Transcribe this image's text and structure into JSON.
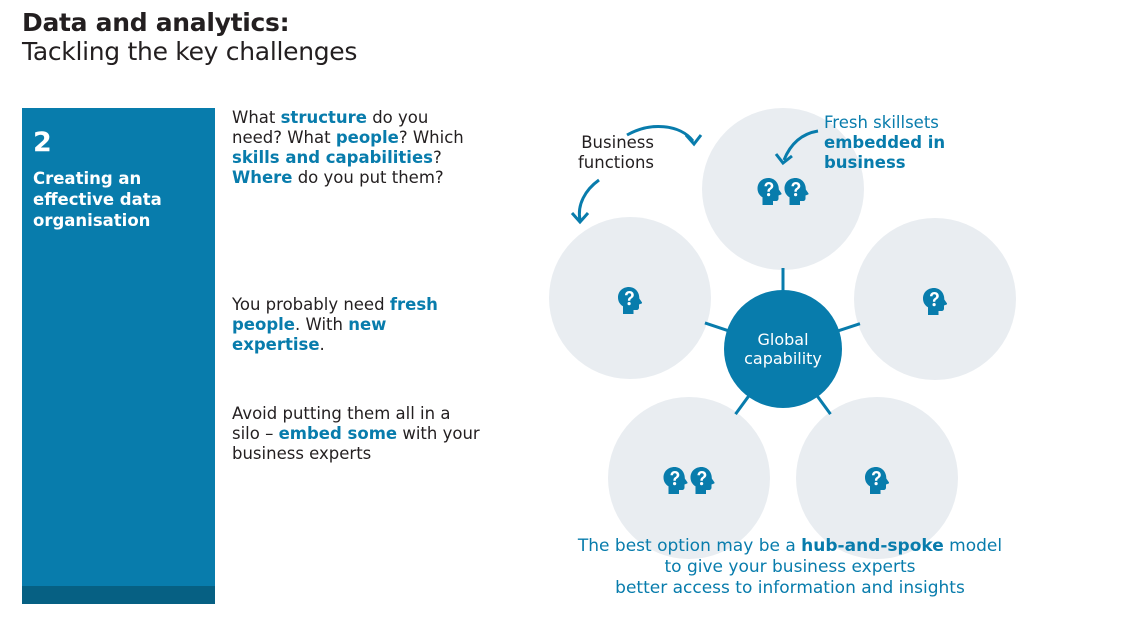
{
  "header": {
    "title": "Data and analytics:",
    "subtitle": "Tackling the key challenges"
  },
  "panel": {
    "number": "2",
    "title": "Creating an effective data organisation",
    "color": "#087cac",
    "band_color": "#066083"
  },
  "body": {
    "p1": [
      {
        "t": "What ",
        "b": false
      },
      {
        "t": "structure",
        "b": true
      },
      {
        "t": " do you need? What ",
        "b": false
      },
      {
        "t": "people",
        "b": true
      },
      {
        "t": "? Which ",
        "b": false
      },
      {
        "t": "skills and capabilities",
        "b": true
      },
      {
        "t": "? ",
        "b": false
      },
      {
        "t": "Where",
        "b": true
      },
      {
        "t": " do you put them?",
        "b": false
      }
    ],
    "p2": [
      {
        "t": "You probably need ",
        "b": false
      },
      {
        "t": "fresh people",
        "b": true
      },
      {
        "t": ". With ",
        "b": false
      },
      {
        "t": "new expertise",
        "b": true
      },
      {
        "t": ".",
        "b": false
      }
    ],
    "p3": [
      {
        "t": "Avoid putting them all in a silo – ",
        "b": false
      },
      {
        "t": "embed some",
        "b": true
      },
      {
        "t": " with your business experts",
        "b": false
      }
    ]
  },
  "diagram": {
    "hub_label_line1": "Global",
    "hub_label_line2": "capability",
    "business_functions_line1": "Business",
    "business_functions_line2": "functions",
    "fresh_skillsets": "Fresh skillsets",
    "embedded_line1": "embedded in",
    "embedded_line2": "business",
    "nodes": [
      {
        "name": "top",
        "heads": 2
      },
      {
        "name": "left",
        "heads": 1
      },
      {
        "name": "right",
        "heads": 1
      },
      {
        "name": "bottom-left",
        "heads": 2
      },
      {
        "name": "bottom-right",
        "heads": 1
      }
    ],
    "icon": "head-question-icon",
    "accent": "#087cac",
    "node_fill": "#e9edf1"
  },
  "caption": {
    "line1_pre": "The best option may be a ",
    "line1_bold": "hub-and-spoke",
    "line1_post": " model",
    "line2": "to give your business experts",
    "line3": "better access to information and insights"
  }
}
